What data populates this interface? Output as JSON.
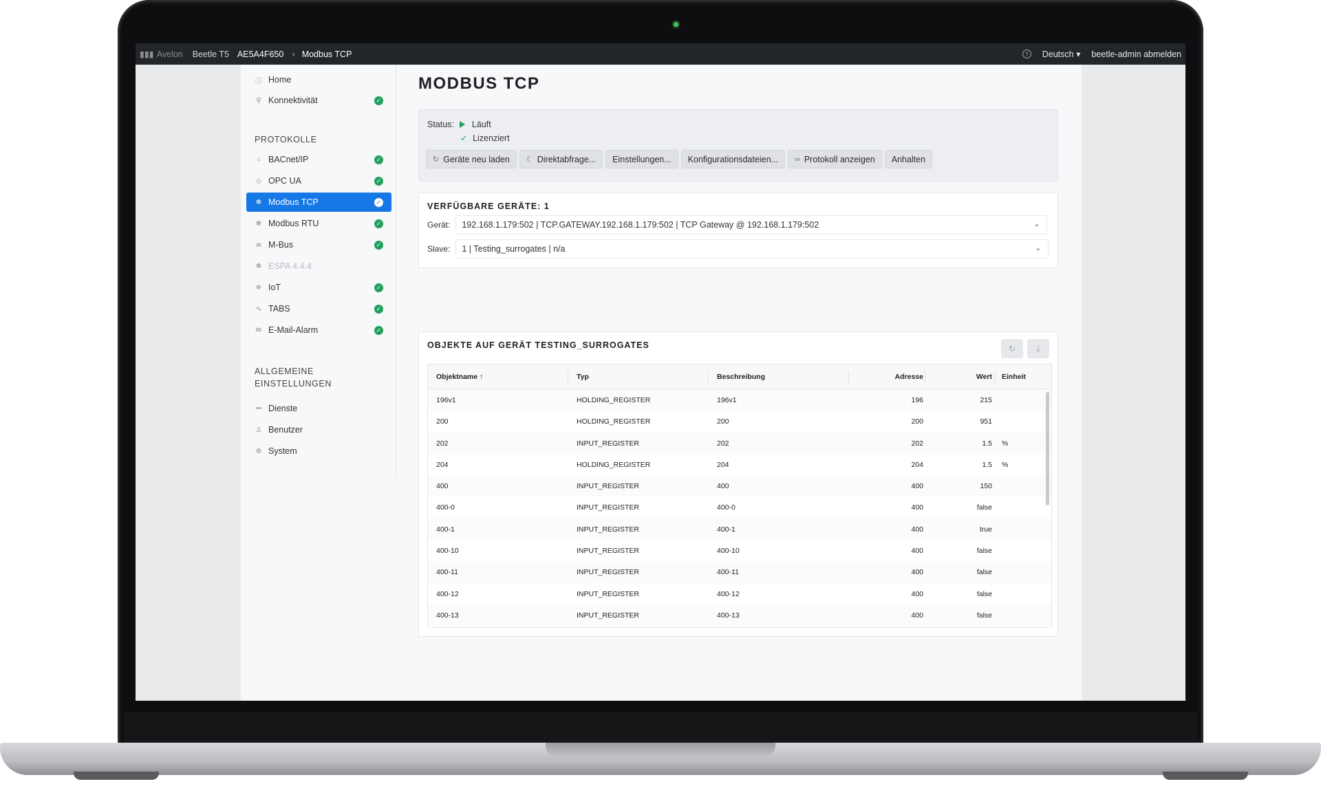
{
  "topbar": {
    "brand": "Avelon",
    "product": "Beetle T5",
    "device": "AE5A4F650",
    "page": "Modbus TCP",
    "language": "Deutsch",
    "logout": "beetle-admin abmelden"
  },
  "sidebar": {
    "home": "Home",
    "connectivity": "Konnektivität",
    "protocols_heading": "PROTOKOLLE",
    "protocols": [
      {
        "label": "BACnet/IP",
        "icon": "circle-icon",
        "checked": true
      },
      {
        "label": "OPC UA",
        "icon": "diamond-icon",
        "checked": true
      },
      {
        "label": "Modbus TCP",
        "icon": "gear-icon",
        "checked": true,
        "active": true
      },
      {
        "label": "Modbus RTU",
        "icon": "gear-icon",
        "checked": true
      },
      {
        "label": "M-Bus",
        "icon": "meter-icon",
        "checked": true
      },
      {
        "label": "ESPA 4.4.4",
        "icon": "gear-icon",
        "checked": false,
        "disabled": true
      },
      {
        "label": "IoT",
        "icon": "network-icon",
        "checked": true
      },
      {
        "label": "TABS",
        "icon": "wave-icon",
        "checked": true
      },
      {
        "label": "E-Mail-Alarm",
        "icon": "mail-icon",
        "checked": true
      }
    ],
    "general_heading_1": "ALLGEMEINE",
    "general_heading_2": "EINSTELLUNGEN",
    "general": [
      {
        "label": "Dienste",
        "icon": "services-icon"
      },
      {
        "label": "Benutzer",
        "icon": "user-icon"
      },
      {
        "label": "System",
        "icon": "cog-icon"
      }
    ]
  },
  "main": {
    "title": "MODBUS TCP",
    "status_label": "Status:",
    "status_value": "Läuft",
    "license": "Lizenziert",
    "buttons": {
      "reload": "Geräte neu laden",
      "direct": "Direktabfrage...",
      "settings": "Einstellungen...",
      "config": "Konfigurationsdateien...",
      "log": "Protokoll anzeigen",
      "stop": "Anhalten"
    },
    "devices_heading": "VERFÜGBARE GERÄTE: 1",
    "device_label": "Gerät:",
    "device_value": "192.168.1.179:502  |  TCP.GATEWAY.192.168.1.179:502  |  TCP Gateway @ 192.168.1.179:502",
    "slave_label": "Slave:",
    "slave_value": "1  |  Testing_surrogates  |  n/a",
    "objects_heading": "OBJEKTE AUF GERÄT TESTING_SURROGATES"
  },
  "table": {
    "headers": {
      "name": "Objektname",
      "type": "Typ",
      "desc": "Beschreibung",
      "addr": "Adresse",
      "value": "Wert",
      "unit": "Einheit"
    },
    "rows": [
      {
        "name": "196v1",
        "type": "HOLDING_REGISTER",
        "desc": "196v1",
        "addr": "196",
        "value": "215",
        "unit": ""
      },
      {
        "name": "200",
        "type": "HOLDING_REGISTER",
        "desc": "200",
        "addr": "200",
        "value": "951",
        "unit": ""
      },
      {
        "name": "202",
        "type": "INPUT_REGISTER",
        "desc": "202",
        "addr": "202",
        "value": "1.5",
        "unit": "%"
      },
      {
        "name": "204",
        "type": "HOLDING_REGISTER",
        "desc": "204",
        "addr": "204",
        "value": "1.5",
        "unit": "%"
      },
      {
        "name": "400",
        "type": "INPUT_REGISTER",
        "desc": "400",
        "addr": "400",
        "value": "150",
        "unit": ""
      },
      {
        "name": "400-0",
        "type": "INPUT_REGISTER",
        "desc": "400-0",
        "addr": "400",
        "value": "false",
        "unit": ""
      },
      {
        "name": "400-1",
        "type": "INPUT_REGISTER",
        "desc": "400-1",
        "addr": "400",
        "value": "true",
        "unit": ""
      },
      {
        "name": "400-10",
        "type": "INPUT_REGISTER",
        "desc": "400-10",
        "addr": "400",
        "value": "false",
        "unit": ""
      },
      {
        "name": "400-11",
        "type": "INPUT_REGISTER",
        "desc": "400-11",
        "addr": "400",
        "value": "false",
        "unit": ""
      },
      {
        "name": "400-12",
        "type": "INPUT_REGISTER",
        "desc": "400-12",
        "addr": "400",
        "value": "false",
        "unit": ""
      },
      {
        "name": "400-13",
        "type": "INPUT_REGISTER",
        "desc": "400-13",
        "addr": "400",
        "value": "false",
        "unit": ""
      }
    ]
  },
  "colors": {
    "accent": "#1677e6",
    "ok": "#20a05a"
  }
}
